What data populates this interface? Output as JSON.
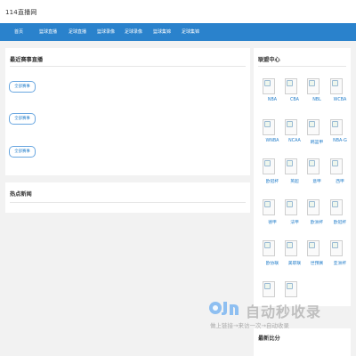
{
  "header": {
    "site_title": "114直播网"
  },
  "nav": {
    "items": [
      {
        "label": "首页"
      },
      {
        "label": "篮球直播"
      },
      {
        "label": "足球直播"
      },
      {
        "label": "篮球录像"
      },
      {
        "label": "足球录像"
      },
      {
        "label": "篮球集锦"
      },
      {
        "label": "足球集锦"
      }
    ]
  },
  "recent": {
    "title": "最近赛事直播",
    "filters": [
      {
        "label": "全部赛事"
      },
      {
        "label": "全部赛事"
      },
      {
        "label": "全部赛事"
      }
    ]
  },
  "news": {
    "title": "热点新闻"
  },
  "league_center": {
    "title": "联盟中心",
    "teams": [
      {
        "name": "NBA"
      },
      {
        "name": "CBA"
      },
      {
        "name": "NBL"
      },
      {
        "name": "WCBA"
      },
      {
        "name": "WNBA"
      },
      {
        "name": "NCAA"
      },
      {
        "name": "韩篮甲"
      },
      {
        "name": "NBA-G"
      },
      {
        "name": "欧冠杯"
      },
      {
        "name": "英超"
      },
      {
        "name": "意甲"
      },
      {
        "name": "西甲"
      },
      {
        "name": "德甲"
      },
      {
        "name": "法甲"
      },
      {
        "name": "欧洲杯"
      },
      {
        "name": "欧冠杯"
      },
      {
        "name": "欧协联"
      },
      {
        "name": "美职联"
      },
      {
        "name": "世预赛"
      },
      {
        "name": "亚洲杯"
      },
      {
        "name": ""
      },
      {
        "name": ""
      }
    ]
  },
  "bottom_right": {
    "title": "最新比分"
  },
  "watermark": {
    "title": "自动秒收录",
    "subtitle": "做上链接→来访一次→自动收录"
  }
}
